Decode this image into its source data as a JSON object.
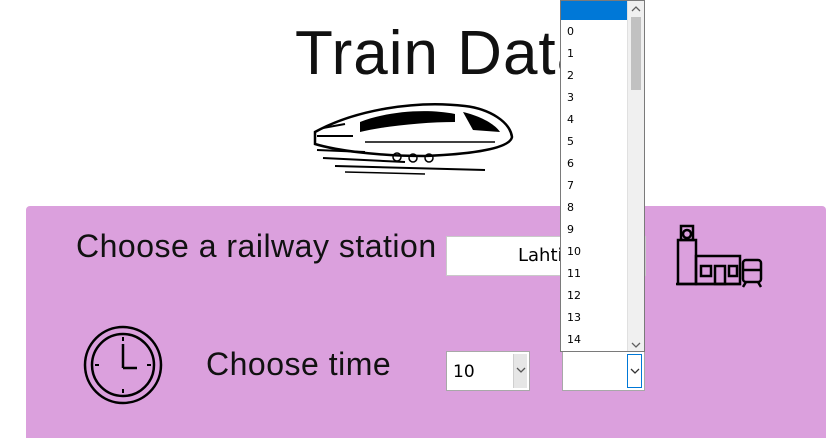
{
  "header": {
    "title": "Train Data",
    "logo_icon": "high-speed-train-icon"
  },
  "station": {
    "label": "Choose a railway station",
    "value": "Lahti",
    "icon": "train-station-icon"
  },
  "time": {
    "label": "Choose time",
    "icon": "clock-icon",
    "hour_value": "10",
    "minute_value": "",
    "minute_options": [
      "0",
      "1",
      "2",
      "3",
      "4",
      "5",
      "6",
      "7",
      "8",
      "9",
      "10",
      "11",
      "12",
      "13",
      "14"
    ]
  },
  "colors": {
    "panel": "#dba0dd",
    "selection": "#0078d7"
  }
}
